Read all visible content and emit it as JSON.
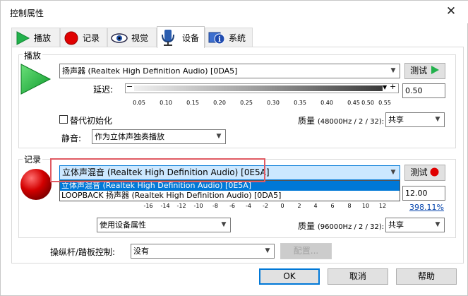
{
  "window": {
    "title": "控制属性",
    "close_glyph": "✕"
  },
  "tabs": [
    {
      "label": "播放",
      "icon": "play-icon"
    },
    {
      "label": "记录",
      "icon": "record-icon"
    },
    {
      "label": "视觉",
      "icon": "eye-icon"
    },
    {
      "label": "设备",
      "icon": "device-icon",
      "active": true
    },
    {
      "label": "系统",
      "icon": "system-info-icon"
    }
  ],
  "playback": {
    "group_label": "播放",
    "device_value": "扬声器 (Realtek High Definition Audio) [0DA5]",
    "test_label": "测试",
    "latency_label": "延迟:",
    "slider_min_btn": "−",
    "slider_max_btn": "+",
    "latency_value": "0.50",
    "ticks": [
      "0.05",
      "0.10",
      "0.15",
      "0.20",
      "0.25",
      "0.30",
      "0.35",
      "0.40",
      "0.45",
      "0.50",
      "0.55"
    ],
    "alt_init_label": "替代初始化",
    "quality_label": "质量",
    "quality_detail": "(48000Hz / 2 / 32):",
    "share_value": "共享",
    "mute_label": "静音:",
    "mute_value": "作为立体声独奏播放"
  },
  "record": {
    "group_label": "记录",
    "device_value": "立体声混音 (Realtek High Definition Audio) [0E5A]",
    "test_label": "测试",
    "dropdown_items": [
      {
        "label": "立体声混音 (Realtek High Definition Audio) [0E5A]",
        "selected": true
      },
      {
        "label": "LOOPBACK 扬声器 (Realtek High Definition Audio) [0DA5]",
        "selected": false
      }
    ],
    "gain_value": "12.00",
    "ticks": [
      "-16",
      "-14",
      "-12",
      "-10",
      "-8",
      "-6",
      "-4",
      "-2",
      "0",
      "2",
      "4",
      "6",
      "8",
      "10",
      "12"
    ],
    "percent_link": "398.11%",
    "use_device_props": "使用设备属性",
    "quality_label": "质量",
    "quality_detail": "(96000Hz / 2 / 32):",
    "share_value": "共享"
  },
  "joystick": {
    "label": "操纵杆/踏板控制:",
    "value": "没有",
    "config_label": "配置..."
  },
  "footer": {
    "ok": "OK",
    "cancel": "取消",
    "help": "帮助"
  },
  "colors": {
    "accent": "#0078d7",
    "play_green": "#22b14c",
    "record_red": "#d40000",
    "highlight_box": "#e05a63"
  }
}
